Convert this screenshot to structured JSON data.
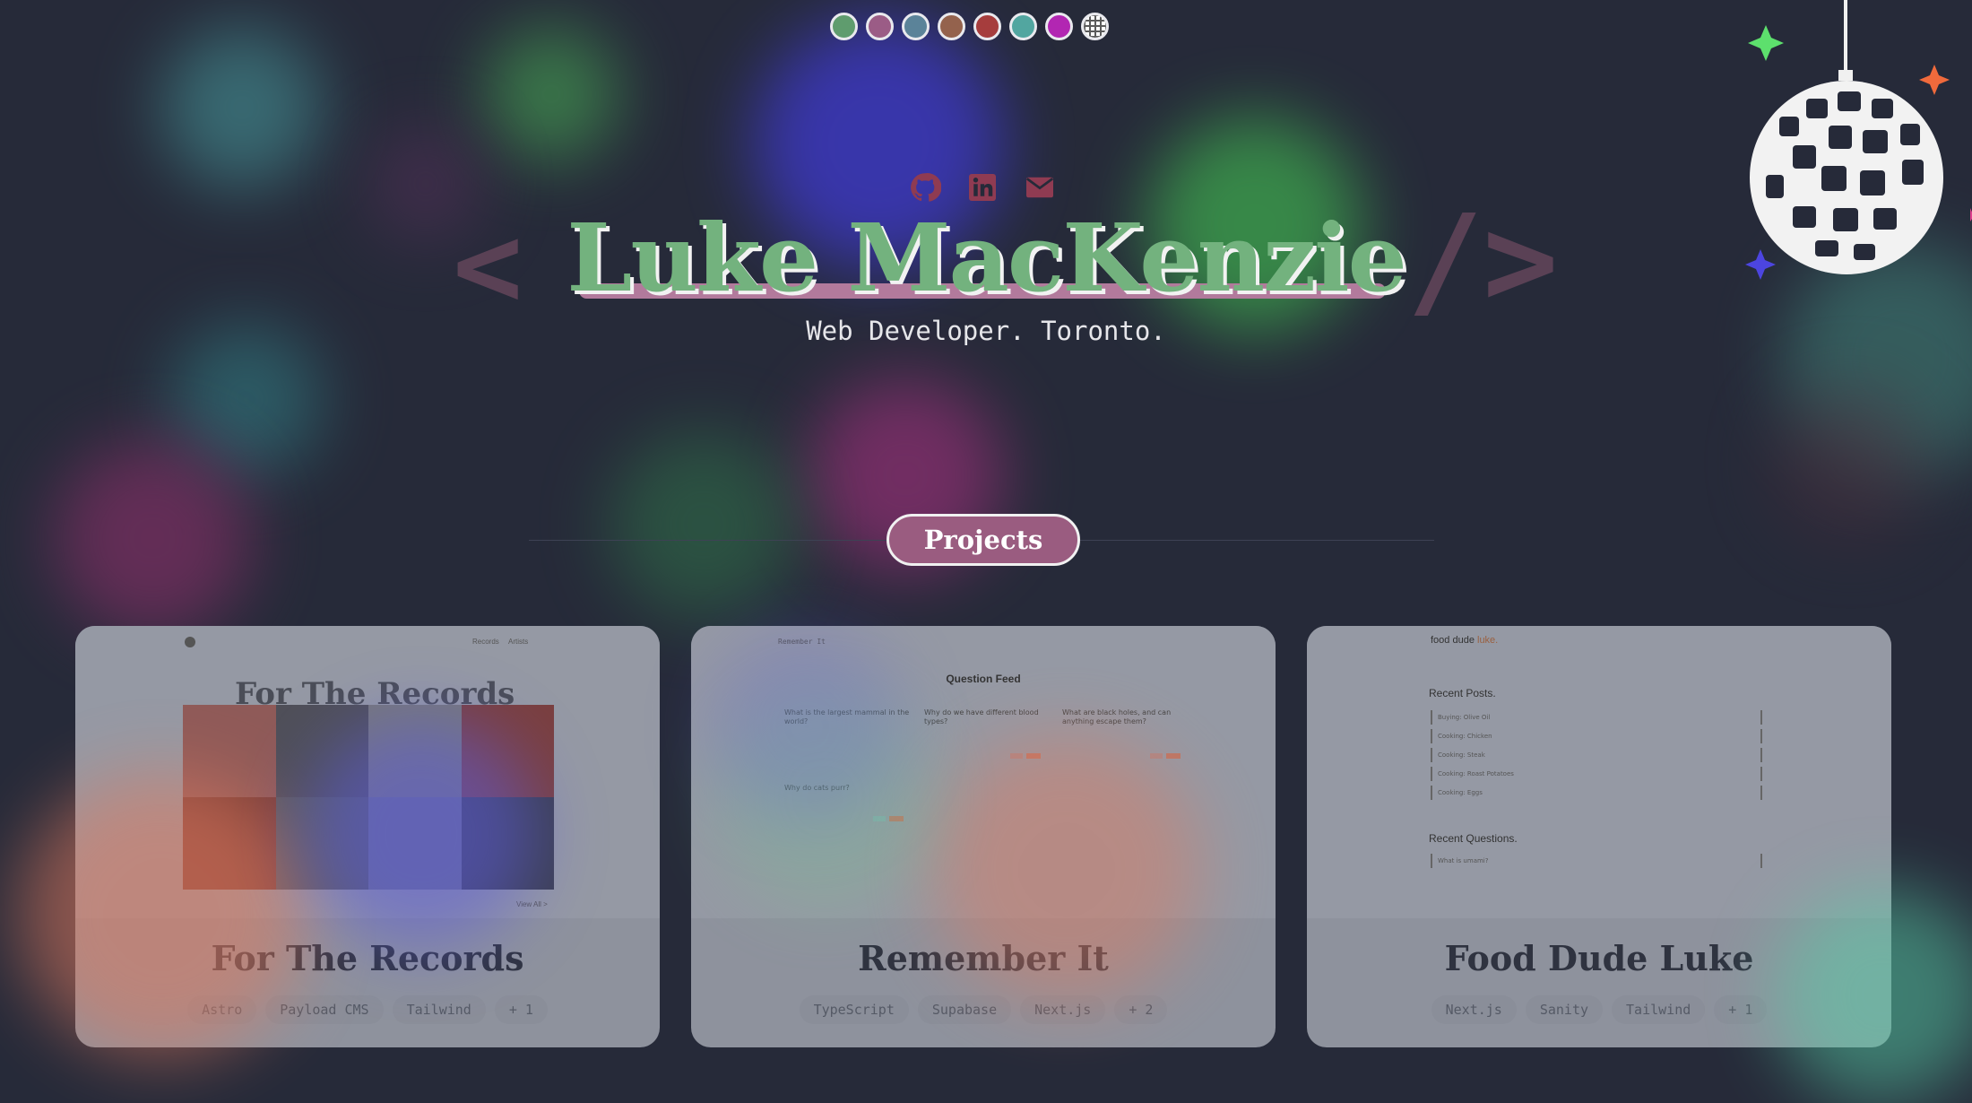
{
  "theme_swatches": [
    {
      "name": "green",
      "color": "#5f9c6e"
    },
    {
      "name": "mauve",
      "color": "#9b5c86"
    },
    {
      "name": "slate-blue",
      "color": "#5b8399"
    },
    {
      "name": "brown",
      "color": "#94624d"
    },
    {
      "name": "red",
      "color": "#a63d3d"
    },
    {
      "name": "teal",
      "color": "#52a6a0"
    },
    {
      "name": "magenta",
      "color": "#b226b2"
    },
    {
      "name": "disco",
      "color": "#ffffff"
    }
  ],
  "hero": {
    "name": "Luke MacKenzie",
    "tagline": "Web Developer. Toronto.",
    "bracket_left": "<",
    "bracket_right": "/>",
    "socials": [
      {
        "icon": "github-icon"
      },
      {
        "icon": "linkedin-icon"
      },
      {
        "icon": "email-icon"
      }
    ]
  },
  "section": {
    "projects_label": "Projects"
  },
  "projects": [
    {
      "title": "For The Records",
      "tags": [
        "Astro",
        "Payload CMS",
        "Tailwind",
        "+ 1"
      ],
      "preview": {
        "heading": "For The Records",
        "nav": [
          "Records",
          "Artists"
        ],
        "footer_link": "View All >"
      }
    },
    {
      "title": "Remember It",
      "tags": [
        "TypeScript",
        "Supabase",
        "Next.js",
        "+ 2"
      ],
      "preview": {
        "brand": "Remember It",
        "heading": "Question Feed",
        "questions": [
          "What is the largest mammal in the world?",
          "Why do we have different blood types?",
          "What are black holes, and can anything escape them?",
          "Why do cats purr?"
        ]
      }
    },
    {
      "title": "Food Dude Luke",
      "tags": [
        "Next.js",
        "Sanity",
        "Tailwind",
        "+ 1"
      ],
      "preview": {
        "brand_a": "food dude",
        "brand_b": "luke.",
        "recent_posts": "Recent Posts.",
        "posts": [
          "Buying: Olive Oil",
          "Cooking: Chicken",
          "Cooking: Steak",
          "Cooking: Roast Potatoes",
          "Cooking: Eggs"
        ],
        "recent_questions": "Recent Questions.",
        "questions": [
          "What is umami?"
        ]
      }
    }
  ],
  "colors": {
    "background": "#262a39",
    "name_green": "#73b27e",
    "underline_pink": "#b27a9c",
    "pill_bg": "#9a5c80",
    "icon_red": "#a63d4f"
  }
}
